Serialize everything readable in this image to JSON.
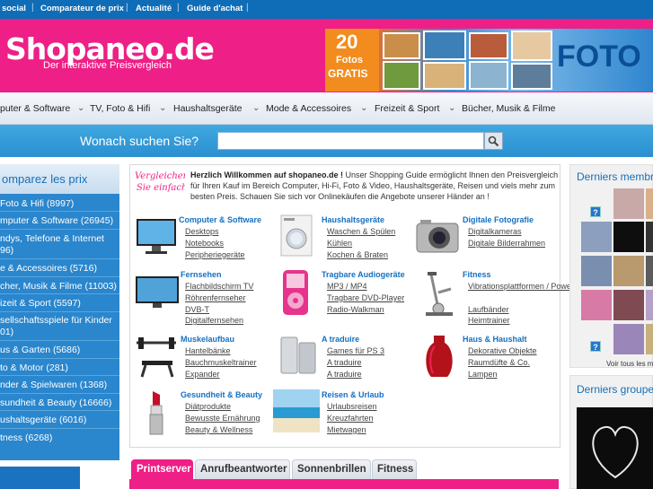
{
  "topbar": {
    "links": [
      "social",
      "Comparateur de prix",
      "Actualité",
      "Guide d'achat"
    ],
    "separator": "|"
  },
  "header": {
    "logo": "Shopaneo.de",
    "tagline": "Der interaktive Preisvergleich",
    "banner": {
      "badge_number": "20",
      "badge_line1": "Fotos",
      "badge_line2": "GRATIS",
      "right_text": "FOTO"
    }
  },
  "nav": {
    "items": [
      "puter & Software",
      "TV, Foto & Hifi",
      "Haushaltsgeräte",
      "Mode & Accessoires",
      "Freizeit & Sport",
      "Bücher, Musik & Filme"
    ]
  },
  "search": {
    "label": "Wonach suchen Sie?",
    "placeholder": ""
  },
  "sidebar": {
    "title": "omparez les prix",
    "categories": [
      [
        "Foto & Hifi (8997)"
      ],
      [
        "mputer & Software (26945)"
      ],
      [
        "ndys, Telefone & Internet",
        "96)"
      ],
      [
        "e & Accessoires (5716)"
      ],
      [
        "cher, Musik & Filme (11003)"
      ],
      [
        "izeit & Sport (5597)"
      ],
      [
        "sellschaftsspiele für Kinder",
        "01)"
      ],
      [
        "us & Garten (5686)"
      ],
      [
        "to & Motor (281)"
      ],
      [
        "nder & Spielwaren (1368)"
      ],
      [
        "sundheit & Beauty (16666)"
      ],
      [
        "ushaltsgeräte (6016)"
      ],
      [
        "tness (6268)"
      ]
    ]
  },
  "welcome": {
    "badge_line1": "Vergleichen",
    "badge_line2": "Sie einfach",
    "bold": "Herzlich Willkommen auf shopaneo.de !",
    "text": " Unser Shopping Guide ermöglicht Ihnen den Preisvergleich für Ihren Kauf im Bereich Computer, Hi-Fi, Foto & Video, Haushaltsgeräte, Reisen und viels mehr zum besten Preis. Schauen Sie sich vor Onlinekäufen die Angebote unserer Händer an !"
  },
  "categories": [
    {
      "title": "Computer & Software",
      "links": [
        "Desktops",
        "Notebooks",
        "Peripheriegeräte"
      ],
      "icon": "monitor-icon"
    },
    {
      "title": "Haushaltsgeräte",
      "links": [
        "Waschen & Spülen",
        "Kühlen",
        "Kochen & Braten"
      ],
      "icon": "washing-machine-icon"
    },
    {
      "title": "Digitale Fotografie",
      "links": [
        "Digitalkameras",
        "Digitale Bilderrahmen"
      ],
      "icon": "camera-icon"
    },
    {
      "title": "Fernsehen",
      "links": [
        "Flachbildschirm TV",
        "Röhrenfernseher",
        "DVB-T",
        "Digitalfernsehen"
      ],
      "icon": "tv-icon"
    },
    {
      "title": "Tragbare Audiogeräte",
      "links": [
        "MP3 / MP4",
        "Tragbare DVD-Player",
        "Radio-Walkman"
      ],
      "icon": "mp3-player-icon"
    },
    {
      "title": "Fitness",
      "links": [
        "Vibrationsplattformen / Power-Plates",
        "Laufbänder",
        "Heimtrainer"
      ],
      "icon": "exercise-bike-icon"
    },
    {
      "title": "Muskelaufbau",
      "links": [
        "Hantelbänke",
        "Bauchmuskeltrainer",
        "Expander"
      ],
      "icon": "weight-bench-icon"
    },
    {
      "title": "A traduire",
      "links": [
        "Games für PS 3",
        "A traduire",
        "A traduire"
      ],
      "icon": "console-icon"
    },
    {
      "title": "Haus & Haushalt",
      "links": [
        "Dekorative Objekte",
        "Raumdüfte & Co.",
        "Lampen"
      ],
      "icon": "vase-icon"
    },
    {
      "title": "Gesundheit & Beauty",
      "links": [
        "Diätprodukte",
        "Bewusste Ernährung",
        "Beauty & Wellness"
      ],
      "icon": "lipstick-icon"
    },
    {
      "title": "Reisen & Urlaub",
      "links": [
        "Urlaubsreisen",
        "Kreuzfahrten",
        "Mietwagen"
      ],
      "icon": "beach-icon"
    }
  ],
  "tabs": [
    "Printserver",
    "Anrufbeantworter",
    "Sonnenbrillen",
    "Fitness"
  ],
  "right": {
    "members_title": "Derniers membr",
    "members_footer": "Voir tous les m",
    "groups_title": "Derniers groupe",
    "unknown_avatar": "?"
  },
  "colors": {
    "brand": "#ee1f86",
    "blue": "#2a86cd",
    "link": "#1670c0"
  }
}
